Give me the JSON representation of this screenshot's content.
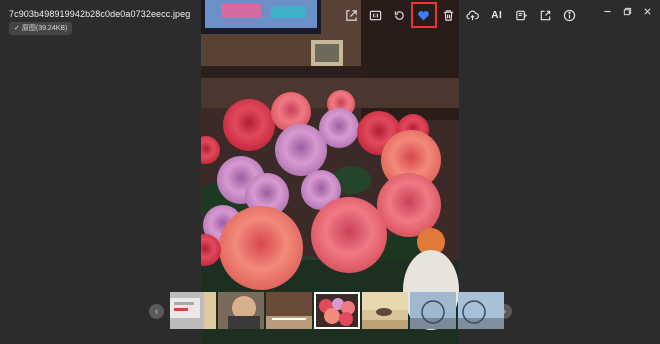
{
  "file": {
    "name": "7c903b498919942b28c0de0a0732eecc.jpeg",
    "original_badge": "原图(39.24KB)"
  },
  "toolbar": {
    "items": [
      {
        "name": "share-icon"
      },
      {
        "name": "original-size-icon",
        "label": "1:1"
      },
      {
        "name": "rotate-icon"
      },
      {
        "name": "favorite-heart-icon",
        "highlighted": true
      },
      {
        "name": "delete-icon"
      },
      {
        "name": "cloud-upload-icon"
      },
      {
        "name": "ai-button",
        "label": "AI"
      },
      {
        "name": "ocr-icon"
      },
      {
        "name": "open-external-icon"
      },
      {
        "name": "info-icon"
      }
    ]
  },
  "window_controls": [
    "minimize-icon",
    "restore-icon",
    "close-icon"
  ],
  "thumbnails": {
    "count": 7,
    "selected_index": 3
  },
  "colors": {
    "background": "#2c2c2c",
    "highlight": "#e53935",
    "heart": "#3d7bff"
  }
}
